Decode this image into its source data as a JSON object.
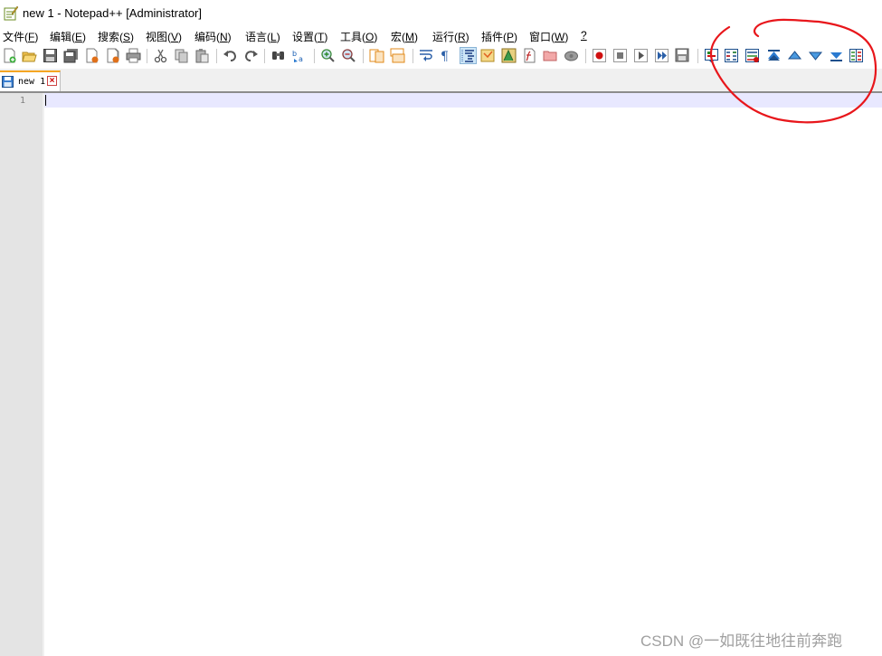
{
  "window": {
    "title": "new 1 - Notepad++ [Administrator]"
  },
  "menu": [
    {
      "label": "文件(",
      "key": "F",
      "tail": ")"
    },
    {
      "label": "编辑(",
      "key": "E",
      "tail": ")"
    },
    {
      "label": "搜索(",
      "key": "S",
      "tail": ")"
    },
    {
      "label": "视图(",
      "key": "V",
      "tail": ")"
    },
    {
      "label": "编码(",
      "key": "N",
      "tail": ")"
    },
    {
      "label": "语言(",
      "key": "L",
      "tail": ")"
    },
    {
      "label": "设置(",
      "key": "T",
      "tail": ")"
    },
    {
      "label": "工具(",
      "key": "O",
      "tail": ")"
    },
    {
      "label": "宏(",
      "key": "M",
      "tail": ")"
    },
    {
      "label": "运行(",
      "key": "R",
      "tail": ")"
    },
    {
      "label": "插件(",
      "key": "P",
      "tail": ")"
    },
    {
      "label": "窗口(",
      "key": "W",
      "tail": ")"
    },
    {
      "label": "",
      "key": "?",
      "tail": ""
    }
  ],
  "toolbar_icons": [
    "new-file-icon",
    "open-file-icon",
    "save-icon",
    "save-all-icon",
    "close-icon",
    "close-all-icon",
    "print-icon",
    "cut-icon",
    "copy-icon",
    "paste-icon",
    "undo-icon",
    "redo-icon",
    "find-icon",
    "replace-icon",
    "zoom-in-icon",
    "zoom-out-icon",
    "sync-vertical-icon",
    "sync-horizontal-icon",
    "word-wrap-icon",
    "show-all-chars-icon",
    "indent-guide-icon",
    "user-language-icon",
    "document-map-icon",
    "function-list-icon",
    "folder-workspace-icon",
    "monitoring-icon",
    "macro-record-icon",
    "macro-stop-icon",
    "macro-play-icon",
    "macro-run-multiple-icon",
    "macro-save-icon",
    "compare-icon",
    "compare-clear-icon",
    "compare-navigation-icon",
    "first-diff-icon",
    "previous-diff-icon",
    "next-diff-icon",
    "last-diff-icon",
    "compare-options-icon"
  ],
  "tab": {
    "label": "new 1",
    "close": "×"
  },
  "editor": {
    "line_numbers": [
      "1"
    ],
    "content": ""
  },
  "watermark": "CSDN @一如既往地往前奔跑",
  "colors": {
    "annotation": "#e8161b",
    "active_tab_accent": "#f5a623",
    "caret_line": "#e8e8ff"
  }
}
